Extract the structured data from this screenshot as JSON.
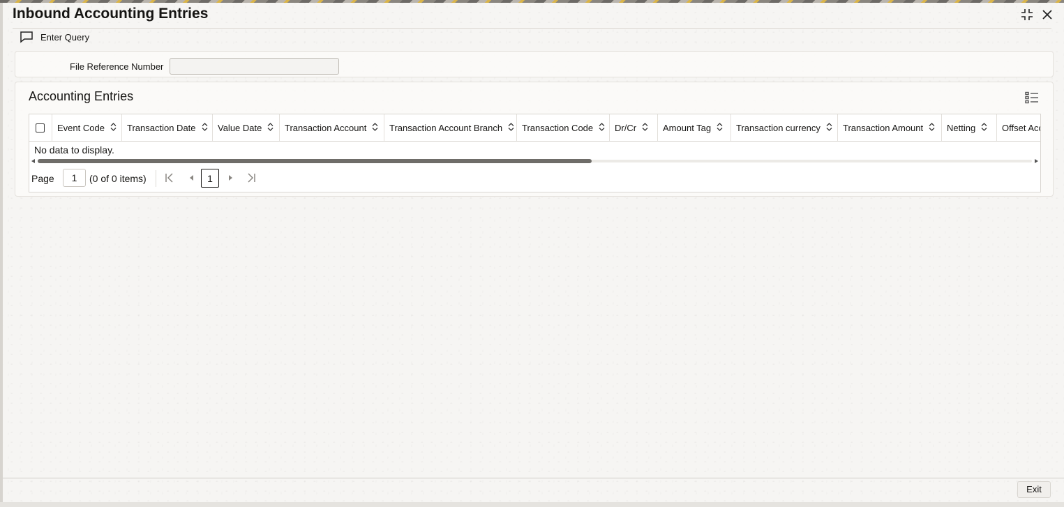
{
  "window": {
    "title": "Inbound Accounting Entries"
  },
  "toolbar": {
    "enter_query_label": "Enter Query"
  },
  "form": {
    "file_reference_label": "File Reference Number",
    "file_reference_value": ""
  },
  "section": {
    "title": "Accounting Entries"
  },
  "grid": {
    "columns": [
      "Event Code",
      "Transaction Date",
      "Value Date",
      "Transaction Account",
      "Transaction Account Branch",
      "Transaction Code",
      "Dr/Cr",
      "Amount Tag",
      "Transaction currency",
      "Transaction Amount",
      "Netting",
      "Offset Acc"
    ],
    "empty_text": "No data to display.",
    "scroll_position_fraction": 0.55
  },
  "pager": {
    "page_label": "Page",
    "page_value": "1",
    "count_text": "(0 of 0 items)",
    "current_page": "1"
  },
  "footer": {
    "exit_label": "Exit"
  }
}
